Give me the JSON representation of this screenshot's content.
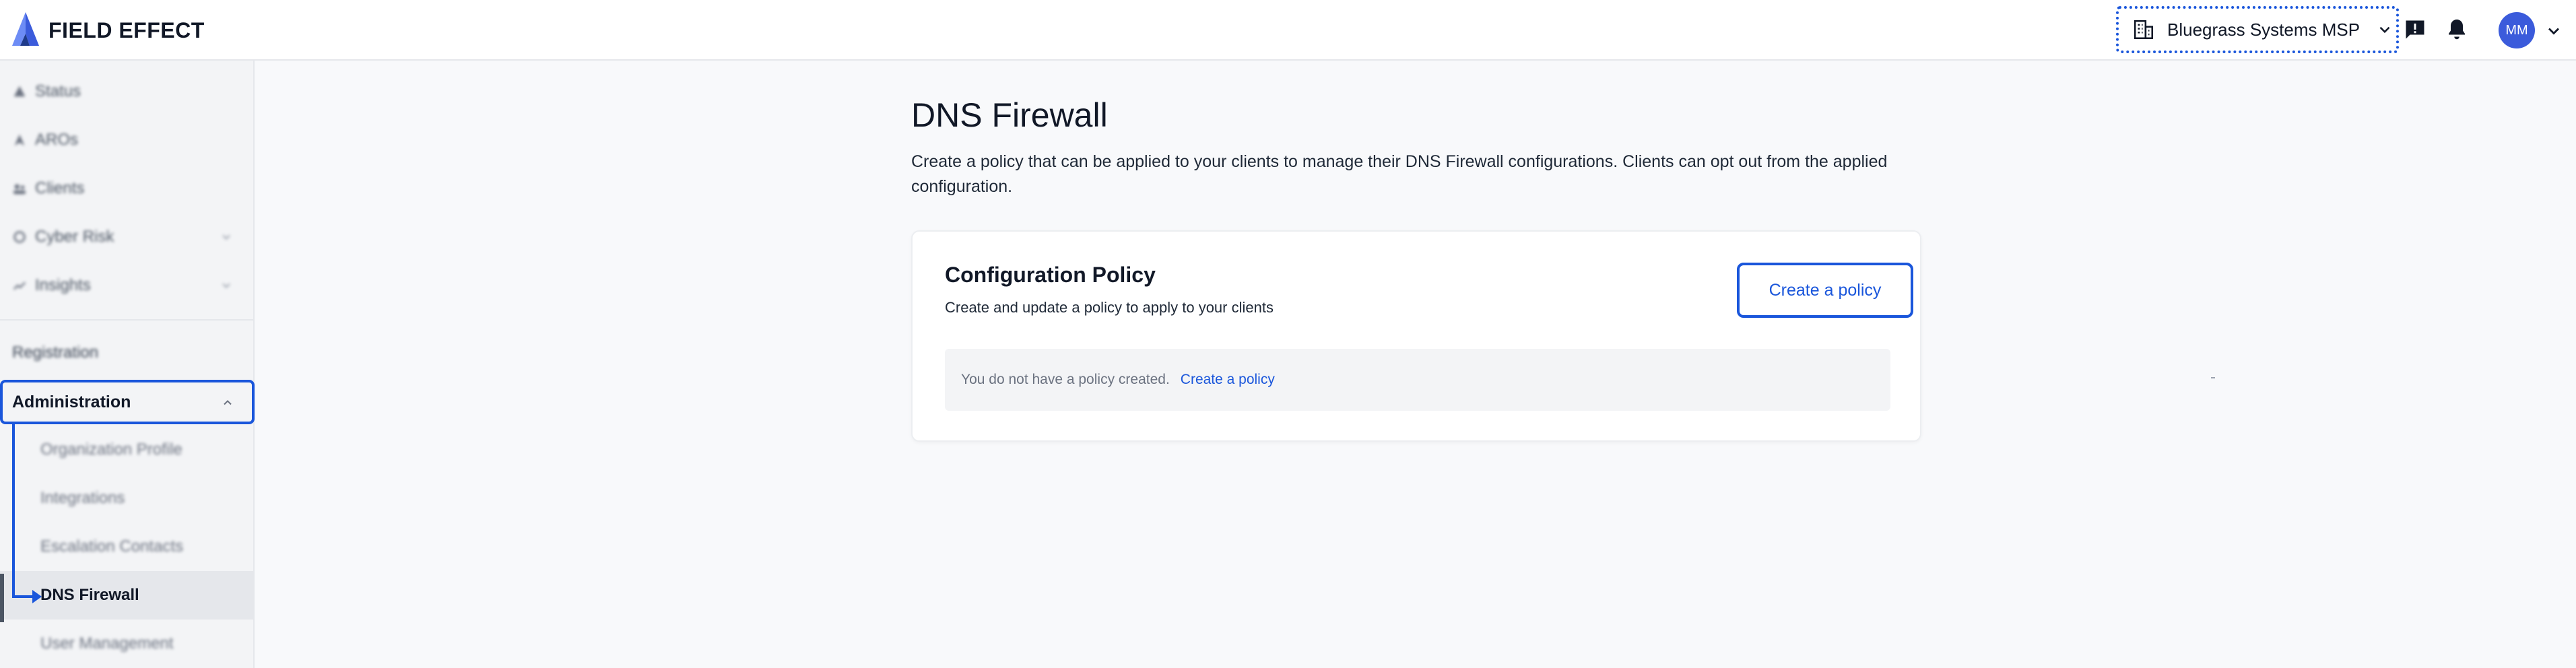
{
  "header": {
    "logo_text": "FIELD EFFECT",
    "org_name": "Bluegrass Systems MSP",
    "avatar_initials": "MM"
  },
  "sidebar": {
    "items": [
      {
        "label": "Status",
        "icon": "status-icon"
      },
      {
        "label": "AROs",
        "icon": "aro-icon"
      },
      {
        "label": "Clients",
        "icon": "clients-icon"
      },
      {
        "label": "Cyber Risk",
        "icon": "cyber-risk-icon"
      },
      {
        "label": "Insights",
        "icon": "insights-icon"
      }
    ],
    "registration_label": "Registration",
    "administration_label": "Administration",
    "admin_subitems": [
      {
        "label": "Organization Profile"
      },
      {
        "label": "Integrations"
      },
      {
        "label": "Escalation Contacts"
      },
      {
        "label": "DNS Firewall"
      },
      {
        "label": "User Management"
      }
    ]
  },
  "main": {
    "title": "DNS Firewall",
    "description": "Create a policy that can be applied to your clients to manage their DNS Firewall configurations. Clients can opt out from the applied configuration.",
    "card": {
      "title": "Configuration Policy",
      "subtitle": "Create and update a policy to apply to your clients",
      "button_label": "Create a policy",
      "empty_text": "You do not have a policy created.",
      "empty_link": "Create a policy"
    }
  },
  "colors": {
    "accent": "#1a56db",
    "avatar": "#3b5bdb",
    "sidebar_bg": "#f3f4f6",
    "page_bg": "#f8f9fb"
  }
}
